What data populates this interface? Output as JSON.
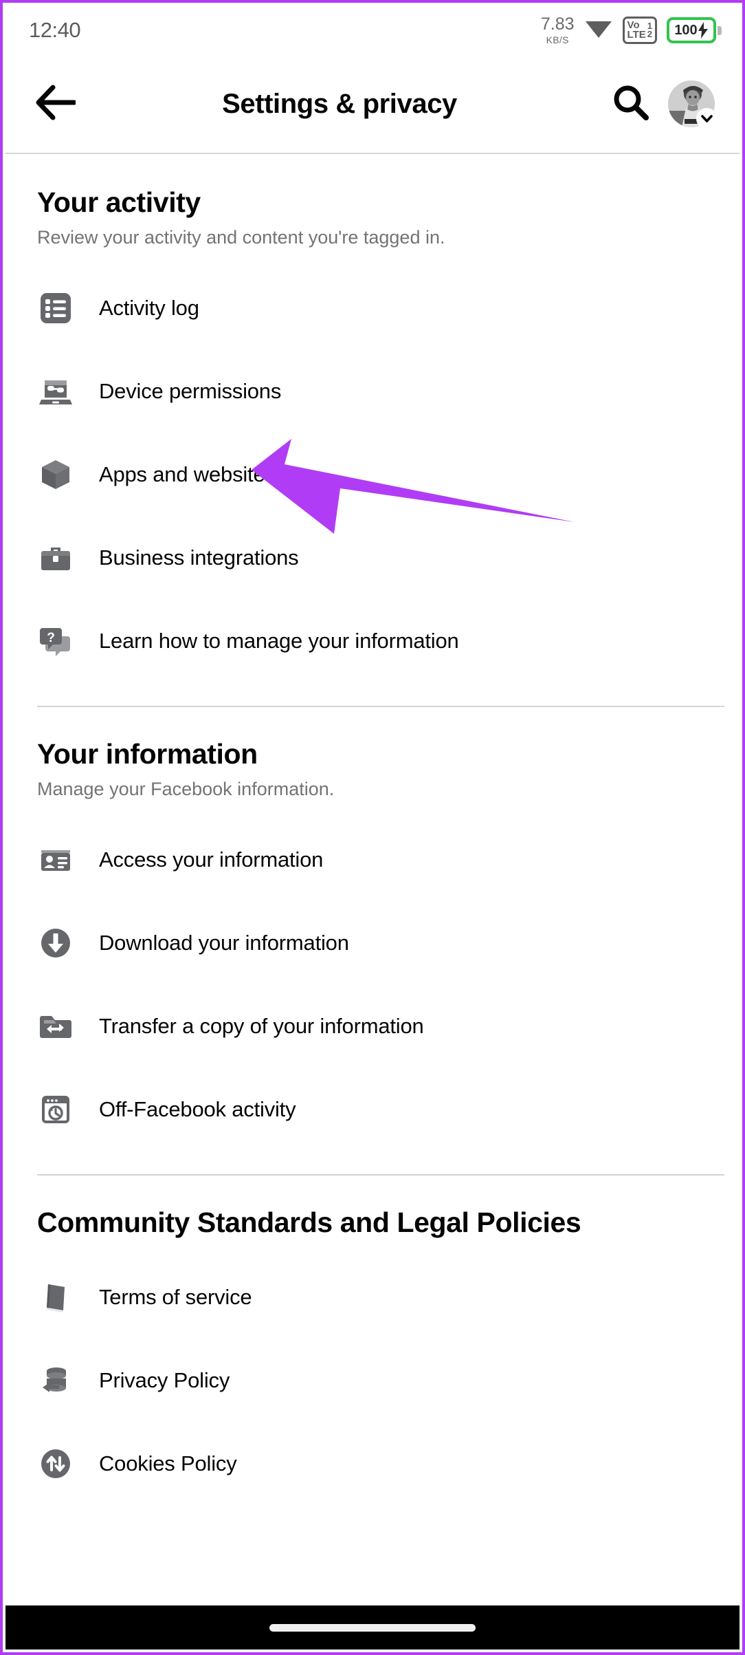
{
  "status_bar": {
    "time": "12:40",
    "network_speed_value": "7.83",
    "network_speed_unit": "KB/S",
    "wifi_icon": "wifi-icon",
    "volte_label_top": "Vo",
    "volte_label_bottom": "LTE",
    "volte_sim_1": "1",
    "volte_sim_2": "2",
    "battery_level": "100",
    "battery_charging": true,
    "battery_color": "#31c44c"
  },
  "header": {
    "back_icon": "arrow-left-icon",
    "title": "Settings & privacy",
    "search_icon": "search-icon",
    "avatar_icon": "avatar",
    "avatar_chevron_icon": "chevron-down-icon"
  },
  "sections": [
    {
      "title": "Your activity",
      "subtitle": "Review your activity and content you're tagged in.",
      "items": [
        {
          "label": "Activity log",
          "icon": "list-icon"
        },
        {
          "label": "Device permissions",
          "icon": "laptop-icon"
        },
        {
          "label": "Apps and websites",
          "icon": "cube-icon"
        },
        {
          "label": "Business integrations",
          "icon": "briefcase-icon"
        },
        {
          "label": "Learn how to manage your information",
          "icon": "question-bubble-icon"
        }
      ]
    },
    {
      "title": "Your information",
      "subtitle": "Manage your Facebook information.",
      "items": [
        {
          "label": "Access your information",
          "icon": "id-card-icon"
        },
        {
          "label": "Download your information",
          "icon": "download-circle-icon"
        },
        {
          "label": "Transfer a copy of your information",
          "icon": "folder-transfer-icon"
        },
        {
          "label": "Off-Facebook activity",
          "icon": "browser-history-icon"
        }
      ]
    },
    {
      "title": "Community Standards and Legal Policies",
      "subtitle": "",
      "items": [
        {
          "label": "Terms of service",
          "icon": "book-icon"
        },
        {
          "label": "Privacy Policy",
          "icon": "database-arrow-icon"
        },
        {
          "label": "Cookies Policy",
          "icon": "transfer-circle-icon"
        }
      ]
    }
  ],
  "annotation": {
    "arrow_icon": "pointer-arrow-icon",
    "arrow_color": "#b03df5",
    "points_to": "Activity log"
  },
  "nav_bar": {
    "home_indicator": "home-indicator-pill"
  },
  "theme": {
    "frame_color": "#b03df5",
    "text_primary": "#050505",
    "text_secondary": "#737373",
    "icon_gray": "#65676b",
    "divider": "#d4d4d4"
  }
}
